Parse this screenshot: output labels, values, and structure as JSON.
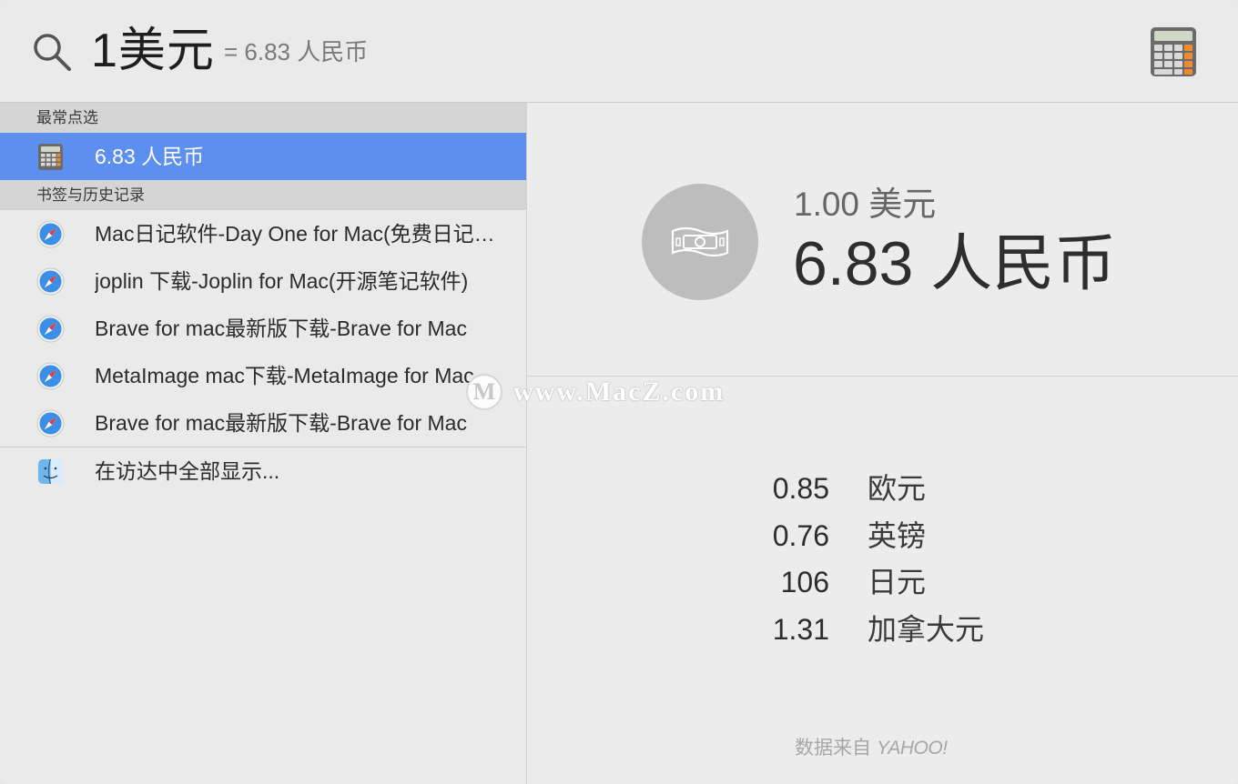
{
  "search": {
    "query": "1美元",
    "inline_result": "= 6.83 人民币"
  },
  "icons": {
    "search": "search-icon",
    "calculator": "calculator-icon",
    "safari": "safari-icon",
    "finder": "finder-icon",
    "money": "money-icon"
  },
  "sections": {
    "top_hit_label": "最常点选",
    "bookmarks_label": "书签与历史记录"
  },
  "top_hit": {
    "label": "6.83 人民币"
  },
  "bookmarks": [
    {
      "label": "Mac日记软件-Day One for Mac(免费日记软件) 下载"
    },
    {
      "label": "joplin 下载-Joplin for Mac(开源笔记软件)"
    },
    {
      "label": "Brave for mac最新版下载-Brave for Mac"
    },
    {
      "label": "MetaImage mac下载-MetaImage for Mac"
    },
    {
      "label": "Brave for mac最新版下载-Brave for Mac"
    }
  ],
  "show_all": {
    "label": "在访达中全部显示..."
  },
  "preview": {
    "from_amount": "1.00 美元",
    "to_amount": "6.83 人民币",
    "rates": [
      {
        "value": "0.85",
        "currency": "欧元"
      },
      {
        "value": "0.76",
        "currency": "英镑"
      },
      {
        "value": "106",
        "currency": "日元"
      },
      {
        "value": "1.31",
        "currency": "加拿大元"
      }
    ],
    "source_prefix": "数据来自",
    "source_brand": "YAHOO!"
  },
  "watermark": {
    "logo": "M",
    "text": "www.MacZ.com"
  },
  "colors": {
    "selection": "#5d8ff0",
    "section_bg": "#d6d5d5"
  }
}
